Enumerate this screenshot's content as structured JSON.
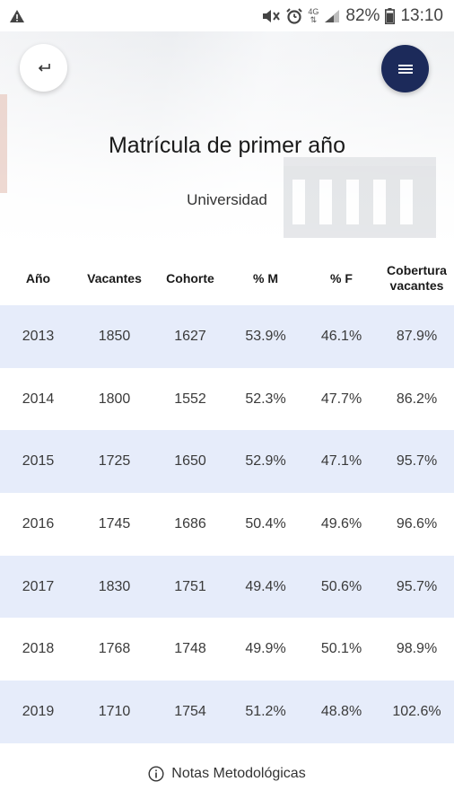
{
  "status_bar": {
    "battery_percent": "82%",
    "time": "13:10",
    "network_label": "4G",
    "icons": [
      "warning-icon",
      "mute-icon",
      "alarm-icon",
      "network-4g-icon",
      "signal-icon",
      "battery-icon"
    ]
  },
  "header": {
    "title": "Matrícula de primer año",
    "subtitle": "Universidad",
    "back_icon": "return-arrow-icon",
    "menu_icon": "hamburger-menu-icon"
  },
  "table": {
    "columns": [
      "Año",
      "Vacantes",
      "Cohorte",
      "% M",
      "% F",
      "Cobertura vacantes"
    ],
    "rows": [
      [
        "2013",
        "1850",
        "1627",
        "53.9%",
        "46.1%",
        "87.9%"
      ],
      [
        "2014",
        "1800",
        "1552",
        "52.3%",
        "47.7%",
        "86.2%"
      ],
      [
        "2015",
        "1725",
        "1650",
        "52.9%",
        "47.1%",
        "95.7%"
      ],
      [
        "2016",
        "1745",
        "1686",
        "50.4%",
        "49.6%",
        "96.6%"
      ],
      [
        "2017",
        "1830",
        "1751",
        "49.4%",
        "50.6%",
        "95.7%"
      ],
      [
        "2018",
        "1768",
        "1748",
        "49.9%",
        "50.1%",
        "98.9%"
      ],
      [
        "2019",
        "1710",
        "1754",
        "51.2%",
        "48.8%",
        "102.6%"
      ]
    ],
    "shaded_row_color": "#e6ecfa"
  },
  "footer": {
    "notes_label": "Notas Metodológicas",
    "notes_icon": "info-icon"
  },
  "colors": {
    "menu_button": "#1c2a5a",
    "shaded_row": "#e6ecfa"
  }
}
